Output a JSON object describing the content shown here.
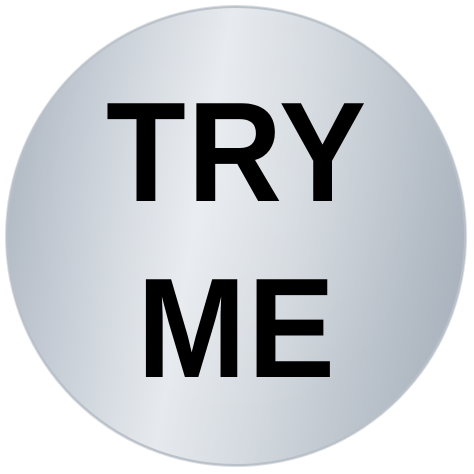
{
  "sticker": {
    "line1": "TRY",
    "line2": "ME",
    "text_color": "#000000",
    "fill_colors": [
      "#a9b2bd",
      "#e6eaee",
      "#a3acb8"
    ]
  }
}
